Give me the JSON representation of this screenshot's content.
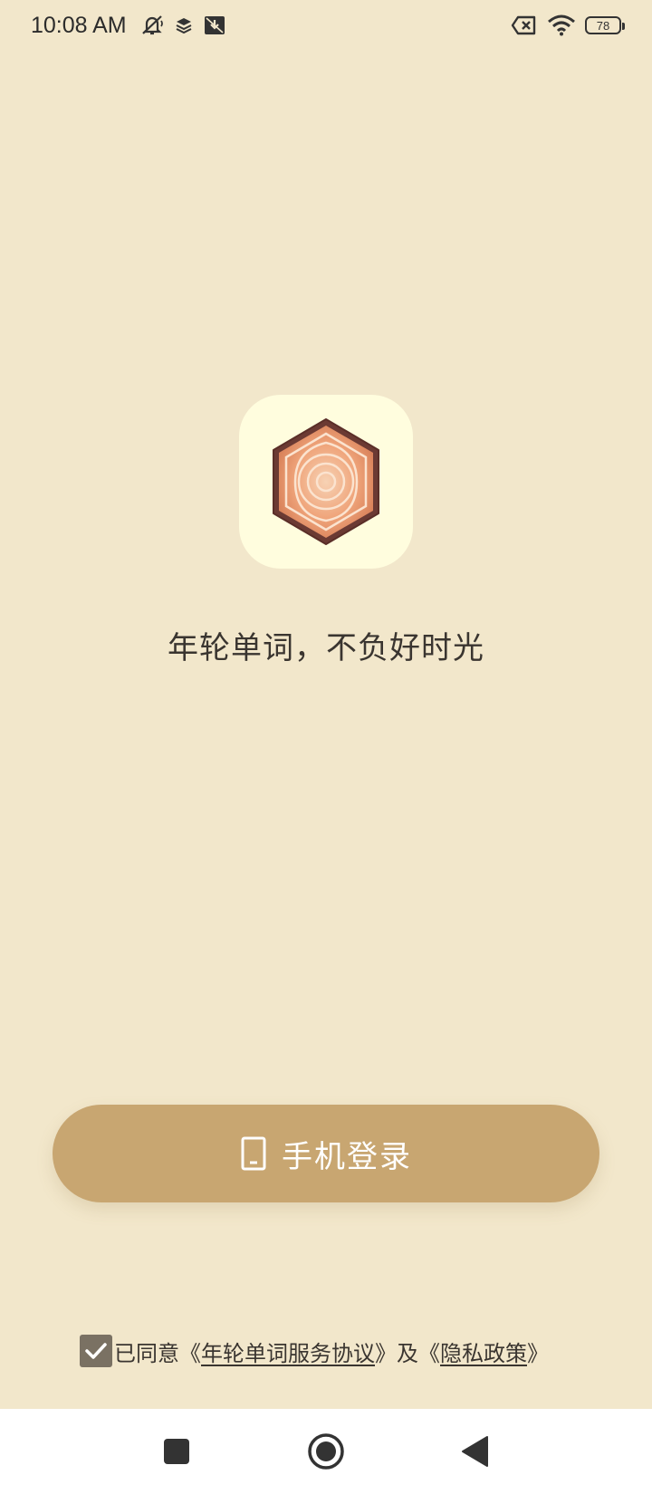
{
  "status_bar": {
    "time": "10:08 AM",
    "battery_level": "78",
    "icons": [
      "mute-icon",
      "layers-icon",
      "download-box-icon",
      "no-sim-icon",
      "wifi-icon",
      "battery-icon"
    ]
  },
  "splash": {
    "slogan": "年轮单词，不负好时光",
    "logo_icon": "tree-ring-hexagon-icon"
  },
  "login": {
    "button_label": "手机登录",
    "icon": "phone-icon"
  },
  "agreement": {
    "checked": true,
    "prefix": "已同意《",
    "service_link": "年轮单词服务协议",
    "middle": "》及《",
    "privacy_link": "隐私政策",
    "suffix": "》"
  },
  "colors": {
    "background": "#F2E7CB",
    "accent": "#C8A671",
    "logo_tile": "#FFFDDE",
    "checkbox": "#7A7163"
  },
  "nav_bar": {
    "icons": [
      "recents-square-icon",
      "home-circle-icon",
      "back-triangle-icon"
    ]
  }
}
